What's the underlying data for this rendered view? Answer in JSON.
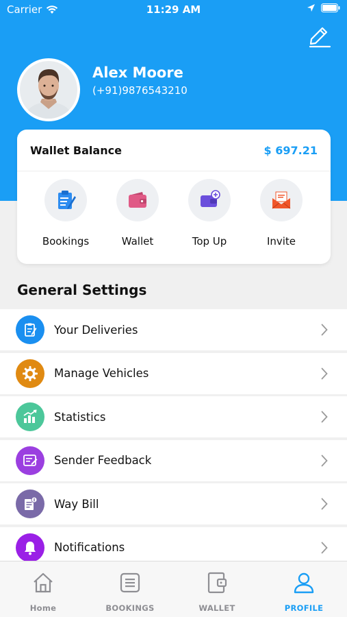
{
  "status_bar": {
    "carrier": "Carrier",
    "time": "11:29 AM"
  },
  "profile": {
    "name": "Alex Moore",
    "phone": "(+91)9876543210"
  },
  "wallet": {
    "label": "Wallet Balance",
    "amount": "$ 697.21",
    "actions": [
      {
        "label": "Bookings",
        "icon": "clipboard-icon",
        "color": "#2d8cf0"
      },
      {
        "label": "Wallet",
        "icon": "wallet-icon",
        "color": "#e05a86"
      },
      {
        "label": "Top Up",
        "icon": "topup-wallet-icon",
        "color": "#6b4fdc"
      },
      {
        "label": "Invite",
        "icon": "envelope-icon",
        "color": "#f0562a"
      }
    ]
  },
  "general_settings": {
    "title": "General Settings",
    "items": [
      {
        "label": "Your Deliveries",
        "icon": "clipboard-icon",
        "color": "#1a8ff0"
      },
      {
        "label": "Manage Vehicles",
        "icon": "gear-icon",
        "color": "#e08a12"
      },
      {
        "label": "Statistics",
        "icon": "bar-chart-icon",
        "color": "#4cc79a"
      },
      {
        "label": "Sender Feedback",
        "icon": "feedback-icon",
        "color": "#9b3fe0"
      },
      {
        "label": "Way Bill",
        "icon": "bill-icon",
        "color": "#7a6aa8"
      },
      {
        "label": "Notifications",
        "icon": "bell-icon",
        "color": "#9a20e6"
      }
    ]
  },
  "tab_bar": {
    "tabs": [
      {
        "label": "Home",
        "icon": "home-icon"
      },
      {
        "label": "BOOKINGS",
        "icon": "list-icon"
      },
      {
        "label": "WALLET",
        "icon": "wallet-icon"
      },
      {
        "label": "PROFILE",
        "icon": "person-icon"
      }
    ],
    "active": "PROFILE",
    "active_color": "#1a9ef5"
  }
}
